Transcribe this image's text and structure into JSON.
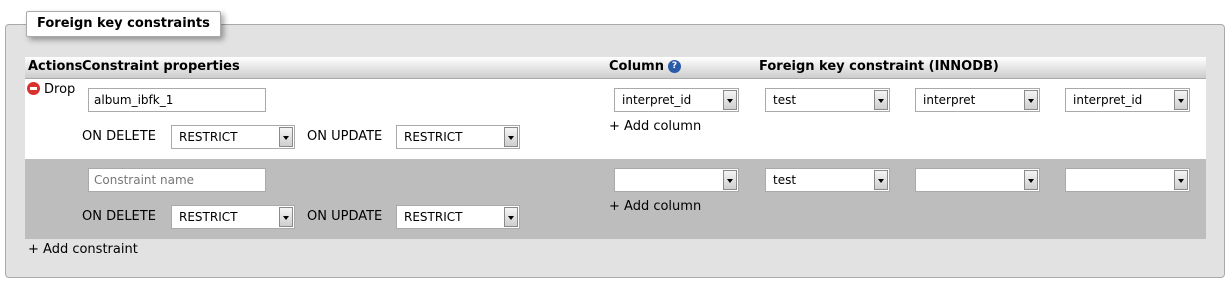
{
  "fieldset": {
    "legend": "Foreign key constraints"
  },
  "headers": {
    "actions": "Actions",
    "constraint_properties": "Constraint properties",
    "column": "Column",
    "foreign_key": "Foreign key constraint (INNODB)"
  },
  "rows": [
    {
      "drop_label": "Drop",
      "constraint_name": "album_ibfk_1",
      "on_delete_label": "ON DELETE",
      "on_delete_value": "RESTRICT",
      "on_update_label": "ON UPDATE",
      "on_update_value": "RESTRICT",
      "column": "interpret_id",
      "add_column": "+ Add column",
      "ref_database": "test",
      "ref_table": "interpret",
      "ref_column": "interpret_id"
    },
    {
      "constraint_placeholder": "Constraint name",
      "on_delete_label": "ON DELETE",
      "on_delete_value": "RESTRICT",
      "on_update_label": "ON UPDATE",
      "on_update_value": "RESTRICT",
      "column": "",
      "add_column": "+ Add column",
      "ref_database": "test",
      "ref_table": "",
      "ref_column": ""
    }
  ],
  "add_constraint": "+ Add constraint",
  "colors": {
    "panel_bg": "#e2e2e2",
    "row_alt_bg": "#bdbdbd",
    "drop_icon": "#d9312b",
    "help_icon": "#2b5aa8"
  },
  "icons": {
    "drop": "minus-circle-icon",
    "help": "question-icon"
  }
}
